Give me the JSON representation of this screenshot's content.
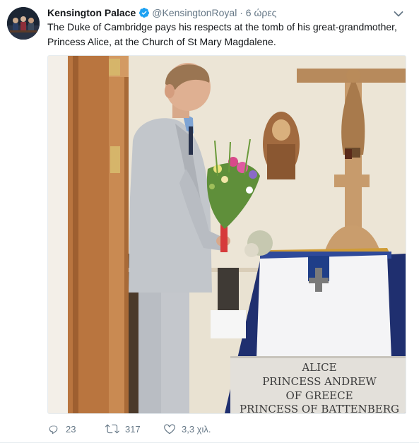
{
  "tweet": {
    "author_name": "Kensington Palace",
    "handle": "@KensingtonRoyal",
    "separator": "·",
    "time": "6 ώρες",
    "text": "The Duke of Cambridge pays his respects at the tomb of his great-grandmother, Princess Alice, at the Church of St Mary Magdalene.",
    "verified_icon": "verified-badge-icon",
    "menu_icon": "chevron-down-icon"
  },
  "photo": {
    "tomb_inscription": [
      "ALICE",
      "PRINCESS ANDREW",
      "OF GREECE",
      "PRINCESS OF BATTENBERG"
    ]
  },
  "actions": {
    "reply_count": "23",
    "retweet_count": "317",
    "like_count": "3,3 χιλ."
  },
  "colors": {
    "verified_blue": "#1da1f2",
    "secondary_text": "#657786"
  }
}
